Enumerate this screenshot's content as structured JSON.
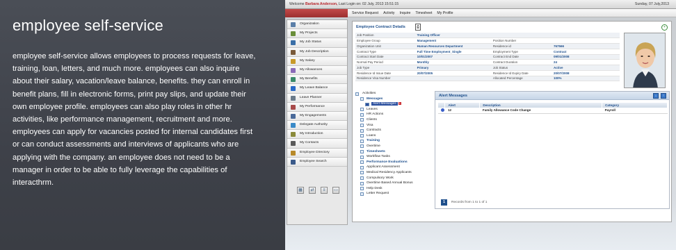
{
  "promo": {
    "title": "employee self-service",
    "body": "employee self-service allows employees to process requests for leave, training, loan, letters, and much more.  employees can also inquire about their salary, vacation/leave balance, benefits. they can enroll in benefit plans, fill in electronic forms, print pay slips, and update their own employee profile.  employees can also play roles in other hr activities, like performance management, recruitment and more.  employees can apply for vacancies posted for internal candidates first or can conduct assessments and interviews of applicants who are applying with the company.  an employee does not need to be a manager in order to be able to fully leverage the capabilities of interacthrm."
  },
  "app": {
    "welcome_prefix": "Welcome",
    "user_name": "Barbara Anderson,",
    "last_login": "Last Login on: 02 July, 2013 15:51:15",
    "date": "Sunday, 07 July,2013",
    "menu": [
      "Service Request",
      "Activity",
      "Inquire",
      "Timesheet",
      "My Profile"
    ]
  },
  "sidebar": {
    "items": [
      {
        "label": "Organization",
        "icon": "organization-icon",
        "color": "#5b7fa8"
      },
      {
        "label": "My Projects",
        "icon": "projects-icon",
        "color": "#6a8f3a"
      },
      {
        "label": "My Job Status",
        "icon": "job-status-icon",
        "color": "#3a6fa8"
      },
      {
        "label": "My Job Description",
        "icon": "job-description-icon",
        "color": "#7a5a3a"
      },
      {
        "label": "My Salary",
        "icon": "salary-icon",
        "color": "#c89a2a"
      },
      {
        "label": "My Allowances",
        "icon": "allowances-icon",
        "color": "#8a6ab8"
      },
      {
        "label": "My Benefits",
        "icon": "benefits-icon",
        "color": "#3a8a6a"
      },
      {
        "label": "My Leave Balance",
        "icon": "leave-balance-icon",
        "color": "#2a6ac8"
      },
      {
        "label": "Leave Planner",
        "icon": "leave-planner-icon",
        "color": "#6a7a8a"
      },
      {
        "label": "My Performance",
        "icon": "performance-icon",
        "color": "#a84a4a"
      },
      {
        "label": "My Engagements",
        "icon": "engagements-icon",
        "color": "#4a6a9a"
      },
      {
        "label": "Delegate Authority",
        "icon": "delegate-icon",
        "color": "#3a8ac8"
      },
      {
        "label": "My Introduction",
        "icon": "introduction-icon",
        "color": "#8a8a3a"
      },
      {
        "label": "My Contacts",
        "icon": "contacts-icon",
        "color": "#5a5a5a"
      },
      {
        "label": "Employee Directory",
        "icon": "directory-icon",
        "color": "#b88a2a"
      },
      {
        "label": "Employee Search",
        "icon": "search-icon",
        "color": "#3a5a8a"
      }
    ],
    "tools": [
      "grid-icon",
      "transfer-icon",
      "list-icon",
      "window-icon"
    ]
  },
  "contract": {
    "title": "Employee Contract Details",
    "rows": [
      [
        "Job Position",
        "Training Officer",
        "",
        ""
      ],
      [
        "Employee Group",
        "Management",
        "Position Number",
        ""
      ],
      [
        "Organization Unit",
        "Human Resources Department",
        "Residence id",
        "767566"
      ],
      [
        "Contract Type",
        "Full Time Employment_Single",
        "Employment Type",
        "Contract"
      ],
      [
        "Contract Start Date",
        "10/01/2007",
        "Contract End Date",
        "09/01/2008"
      ],
      [
        "Normal Pay Period",
        "Monthly",
        "Contract Duration",
        "24"
      ],
      [
        "Job Type",
        "Primary",
        "Job Status",
        "Active"
      ],
      [
        "Residence Id Issue Date",
        "20/07/2005",
        "Residence Id Expiry Date",
        "20/07/2008"
      ],
      [
        "Residence Visa Number",
        "",
        "Allocated Percentage",
        "100%"
      ]
    ]
  },
  "tree": {
    "root": "Activities",
    "nodes": [
      {
        "label": "Messages",
        "level": 1,
        "highlight": true
      },
      {
        "label": "Alert Messages",
        "level": 2,
        "selected": true
      },
      {
        "label": "Leaves",
        "level": 1
      },
      {
        "label": "HR Actions",
        "level": 1
      },
      {
        "label": "Clients",
        "level": 1
      },
      {
        "label": "Visa",
        "level": 1
      },
      {
        "label": "Contracts",
        "level": 1
      },
      {
        "label": "Loans",
        "level": 1
      },
      {
        "label": "Training",
        "level": 1,
        "highlight": true
      },
      {
        "label": "Overtime",
        "level": 1
      },
      {
        "label": "Timesheets",
        "level": 1,
        "highlight": true
      },
      {
        "label": "Workflow Tasks",
        "level": 1
      },
      {
        "label": "Performance Evaluations",
        "level": 1,
        "highlight": true
      },
      {
        "label": "Applicant Assessment",
        "level": 1
      },
      {
        "label": "Medical Residency Applicants",
        "level": 1
      },
      {
        "label": "Compulsory Work",
        "level": 1
      },
      {
        "label": "Overtime Based Annual Bonus",
        "level": 1
      },
      {
        "label": "Help Desk",
        "level": 1
      },
      {
        "label": "Letter Request",
        "level": 1
      }
    ],
    "badge": "1"
  },
  "alerts": {
    "title": "Alert Messages",
    "columns": [
      "",
      "Alert",
      "Description",
      "Category"
    ],
    "rows": [
      {
        "alert": "12",
        "description": "Family Allowance Code Change",
        "category": "Payroll"
      }
    ],
    "page": "1",
    "records_text": "Records from 1 to 1 of 1"
  }
}
